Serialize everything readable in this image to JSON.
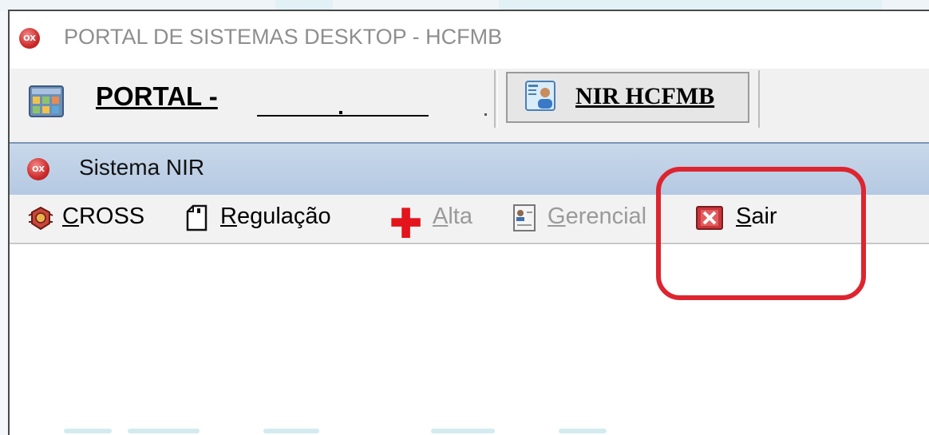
{
  "window": {
    "title": "PORTAL DE SISTEMAS DESKTOP - HCFMB",
    "app_icon_text": "OX"
  },
  "tabs": [
    {
      "label": "PORTAL -",
      "icon": "portal-grid-icon",
      "active": false
    },
    {
      "label": "NIR HCFMB",
      "icon": "user-badge-icon",
      "active": true
    }
  ],
  "child_window": {
    "title": "Sistema NIR",
    "icon_text": "OX"
  },
  "menu": [
    {
      "label": "CROSS",
      "mnemonic": "C",
      "icon": "crest-icon",
      "enabled": true
    },
    {
      "label": "Regulação",
      "mnemonic": "R",
      "icon": "document-icon",
      "enabled": true
    },
    {
      "label": "Alta",
      "mnemonic": "A",
      "icon": "red-cross-icon",
      "enabled": false
    },
    {
      "label": "Gerencial",
      "mnemonic": "G",
      "icon": "id-card-icon",
      "enabled": false
    },
    {
      "label": "Sair",
      "mnemonic": "S",
      "icon": "exit-icon",
      "enabled": true
    }
  ],
  "colors": {
    "highlight": "#dd2530",
    "header_blue": "#b4c9e2",
    "disabled_text": "#9a9a9a"
  }
}
